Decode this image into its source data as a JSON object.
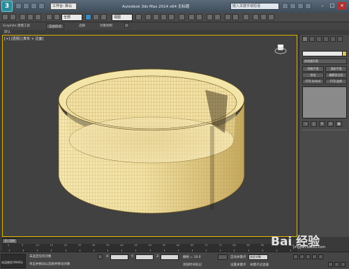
{
  "titlebar": {
    "logo": "3",
    "workspace": "工作台: 默认",
    "title": "Autodesk 3ds Max 2014 x64  无标题",
    "search_placeholder": "键入关键字或短语"
  },
  "toolbar": {
    "filter": "全部",
    "view": "视图"
  },
  "ribbon": {
    "tabs": [
      "Graphite 建模工具",
      "自由形式",
      "选择",
      "对象绘制"
    ],
    "active_index": 1,
    "sub_label": "默认"
  },
  "viewport": {
    "label": "[+] [透视] [真实 + 边面]",
    "accent_color": "#e0b400",
    "object_color": "#f0dfa0"
  },
  "command_panel": {
    "modifier_list": "修改器列表",
    "buttons": [
      "网格平滑",
      "涡轮平滑",
      "挤出",
      "编辑多边形",
      "FFD 4x4x4",
      "FFD 选择",
      "UVW 贴图",
      "UVW 展开"
    ],
    "stack_icons": [
      "⊣",
      "|",
      "∀",
      "⊙",
      "▣"
    ]
  },
  "time_slider": {
    "position": "0 / 100",
    "ticks": [
      "0",
      "5",
      "10",
      "15",
      "20",
      "25",
      "30",
      "35",
      "40",
      "45",
      "50",
      "55",
      "60",
      "65",
      "70",
      "75",
      "80",
      "85",
      "90",
      "95",
      "100"
    ]
  },
  "status_bar": {
    "maxscript_label": "欢迎使用 MAXSc",
    "status_line1": "未选定任何对象",
    "status_line2": "单击并拖动以选择并移动对象",
    "x_label": "X:",
    "y_label": "Y:",
    "z_label": "Z:",
    "grid": "栅格 = 10.0",
    "add_time_tag": "添加时间标记",
    "auto_key": "自动关键点",
    "set_key": "设置关键点",
    "selected": "选定对象",
    "key_filters": "关键点过滤器"
  },
  "watermark": {
    "text": "Bai 经验",
    "sub": "jingyan.baidu.com"
  }
}
